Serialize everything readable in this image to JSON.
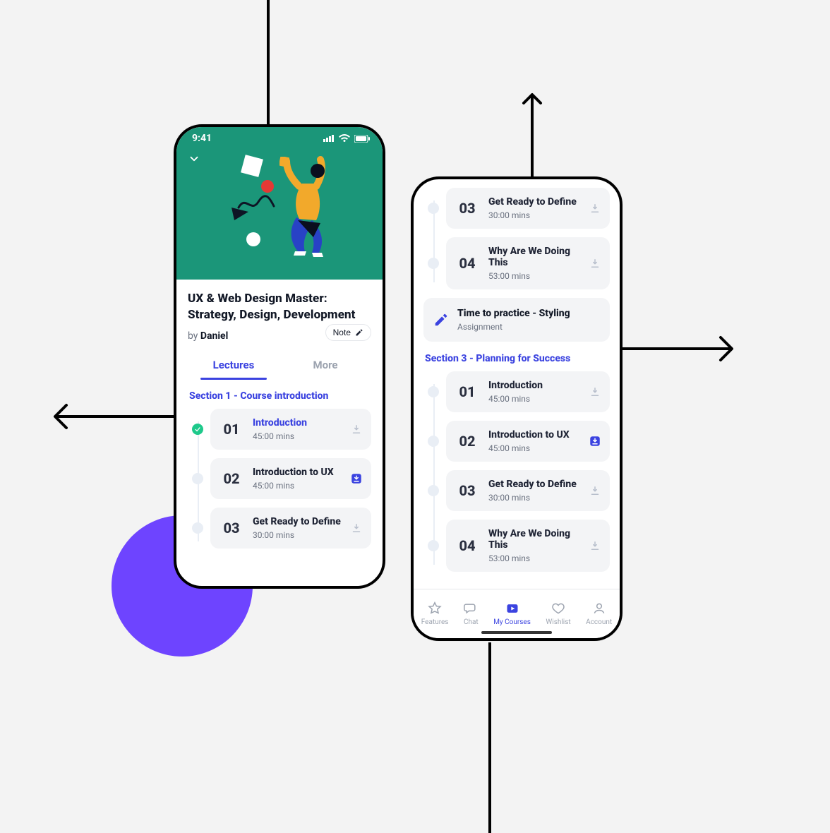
{
  "status": {
    "time": "9:41"
  },
  "left": {
    "title_line1": "UX & Web Design Master:",
    "title_line2": "Strategy, Design, Development",
    "by_prefix": "by ",
    "author": "Daniel",
    "note_label": "Note",
    "tabs": {
      "lectures": "Lectures",
      "more": "More"
    },
    "section1_title": "Section 1 - Course introduction",
    "items": [
      {
        "num": "01",
        "title": "Introduction",
        "sub": "45:00 mins",
        "active": true,
        "done": true,
        "dl": "idle"
      },
      {
        "num": "02",
        "title": "Introduction to UX",
        "sub": "45:00 mins",
        "active": false,
        "done": false,
        "dl": "active"
      },
      {
        "num": "03",
        "title": "Get Ready to Define",
        "sub": "30:00 mins",
        "active": false,
        "done": false,
        "dl": "idle"
      }
    ]
  },
  "right": {
    "top_items": [
      {
        "num": "03",
        "title": "Get Ready to Define",
        "sub": "30:00 mins",
        "dl": "idle"
      },
      {
        "num": "04",
        "title": "Why Are We Doing This",
        "sub": "53:00 mins",
        "dl": "idle"
      }
    ],
    "assignment": {
      "title": "Time to practice - Styling",
      "sub": "Assignment"
    },
    "section3_title": "Section 3 - Planning for Success",
    "items": [
      {
        "num": "01",
        "title": "Introduction",
        "sub": "45:00 mins",
        "dl": "idle"
      },
      {
        "num": "02",
        "title": "Introduction to UX",
        "sub": "45:00 mins",
        "dl": "active"
      },
      {
        "num": "03",
        "title": "Get Ready to Define",
        "sub": "30:00 mins",
        "dl": "idle"
      },
      {
        "num": "04",
        "title": "Why Are We Doing This",
        "sub": "53:00 mins",
        "dl": "idle"
      }
    ],
    "tabs": {
      "features": "Features",
      "chat": "Chat",
      "courses": "My Courses",
      "wishlist": "Wishlist",
      "account": "Account"
    }
  }
}
